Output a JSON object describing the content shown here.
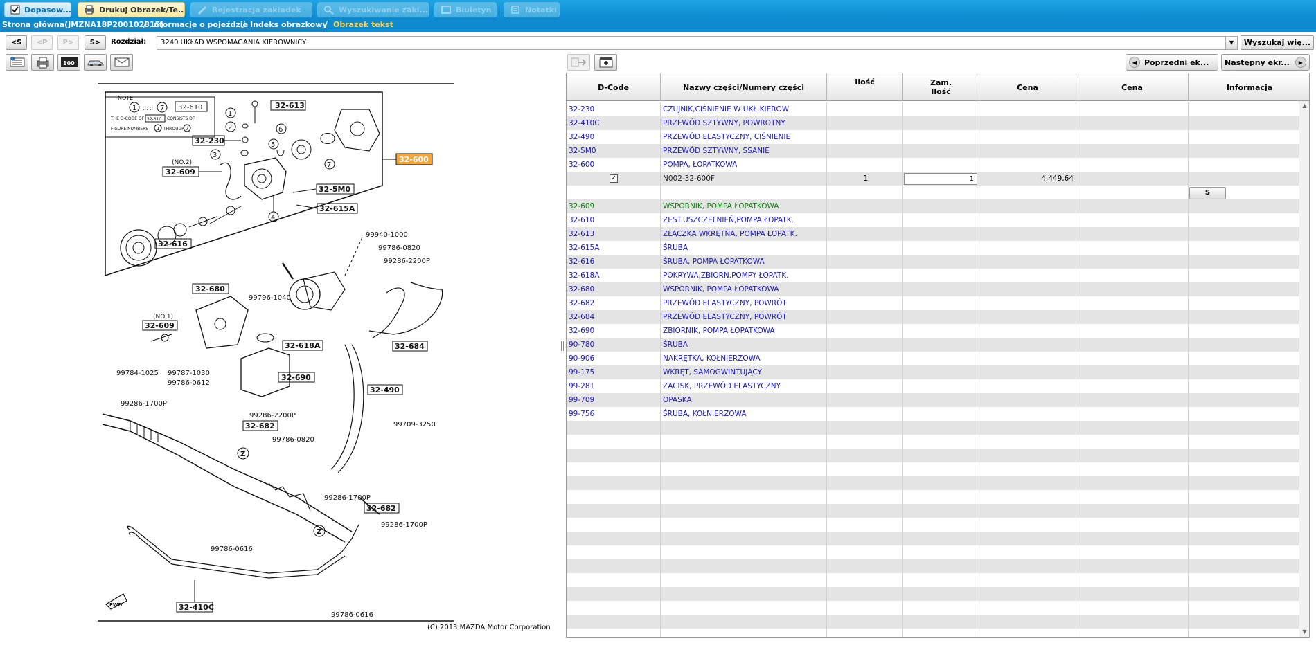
{
  "tabs": [
    {
      "label": "Dopasow...",
      "icon": "checkbox-icon",
      "state": "active-blue"
    },
    {
      "label": "Drukuj Obrazek/Te...",
      "icon": "printer-icon",
      "state": "active-yellow"
    },
    {
      "label": "Rejestracja zakładek",
      "icon": "pen-icon",
      "state": "disabled"
    },
    {
      "label": "Wyszukiwanie zaki...",
      "icon": "magnifier-icon",
      "state": "disabled"
    },
    {
      "label": "Biuletyn",
      "icon": "bulletin-icon",
      "state": "disabled"
    },
    {
      "label": "Notatki",
      "icon": "note-icon",
      "state": "disabled"
    }
  ],
  "breadcrumb": {
    "home": "Strona główna(JMZNA18P200102815)",
    "vehicle_info": "Informacje o pojeździe",
    "image_index": "Indeks obrazkowy",
    "current": "Obrazek tekst"
  },
  "section_nav": {
    "first": "<S",
    "prev": "<P",
    "next": "P>",
    "last": "S>",
    "label": "Rozdział:",
    "selected": "3240  UKŁAD WSPOMAGANIA KIEROWNICY",
    "search_button": "Wyszukaj wię..."
  },
  "paging": {
    "prev": "Poprzedni ek...",
    "next": "Następny ekr..."
  },
  "diagram": {
    "copyright": "(C) 2013 MAZDA Motor Corporation",
    "callouts": [
      "32-610",
      "32-613",
      "32-230",
      "32-609",
      "32-600",
      "32-5M0",
      "32-615A",
      "32-616",
      "32-680",
      "32-609",
      "32-618A",
      "32-684",
      "32-690",
      "32-490",
      "32-682",
      "32-682",
      "32-410C"
    ],
    "part_refs": [
      "99940-1000",
      "99786-0820",
      "99286-2200P",
      "99796-1040",
      "99784-1025",
      "99787-1030",
      "99786-0612",
      "99286-1700P",
      "99286-2200P",
      "99709-3250",
      "99786-0820",
      "99286-1700P",
      "99286-1700P",
      "99786-0616",
      "99786-0616"
    ],
    "note_title": "NOTE",
    "note_line1": "THE D-CODE OF",
    "note_code": "32-610",
    "note_line1b": "CONSISTS OF",
    "note_line2": "FIGURE NUMBERS",
    "note_line2b": "THROUGH",
    "no2": "(NO.2)",
    "no1": "(NO.1)",
    "fwd": "FWD"
  },
  "table": {
    "headers": {
      "dcode": "D-Code",
      "name": "Nazwy części/Numery części",
      "qty": "Ilość",
      "order_qty_1": "Zam.",
      "order_qty_2": "Ilość",
      "price1": "Cena",
      "price2": "Cena",
      "info": "Informacja"
    },
    "rows": [
      {
        "code": "32-230",
        "name": "CZUJNIK,CIŚNIENIE W UKŁ.KIEROW",
        "color": "blue"
      },
      {
        "code": "32-410C",
        "name": "PRZEWÓD SZTYWNY, POWROTNY",
        "color": "blue"
      },
      {
        "code": "32-490",
        "name": "PRZEWÓD ELASTYCZNY, CIŚNIENIE",
        "color": "blue"
      },
      {
        "code": "32-5M0",
        "name": "PRZEWÓD SZTYWNY, SSANIE",
        "color": "blue"
      },
      {
        "code": "32-600",
        "name": "POMPA, ŁOPATKOWA",
        "color": "blue"
      },
      {
        "code": "",
        "name": "N002-32-600F",
        "color": "dark",
        "qty": "1",
        "order_qty": "1",
        "price": "4,449,64",
        "checked": true
      },
      {
        "code": "",
        "name": "",
        "color": "dark",
        "button": "S"
      },
      {
        "code": "32-609",
        "name": "WSPORNIK, POMPA ŁOPATKOWA",
        "color": "green"
      },
      {
        "code": "32-610",
        "name": "ZEST.USZCZELNIEŃ,POMPA ŁOPATK.",
        "color": "blue"
      },
      {
        "code": "32-613",
        "name": "ZŁĄCZKA WKRĘTNA, POMPA ŁOPATK.",
        "color": "blue"
      },
      {
        "code": "32-615A",
        "name": "ŚRUBA",
        "color": "blue"
      },
      {
        "code": "32-616",
        "name": "ŚRUBA, POMPA ŁOPATKOWA",
        "color": "blue"
      },
      {
        "code": "32-618A",
        "name": "POKRYWA,ZBIORN.POMPY ŁOPATK.",
        "color": "blue"
      },
      {
        "code": "32-680",
        "name": "WSPORNIK, POMPA ŁOPATKOWA",
        "color": "blue"
      },
      {
        "code": "32-682",
        "name": "PRZEWÓD ELASTYCZNY, POWRÓT",
        "color": "blue"
      },
      {
        "code": "32-684",
        "name": "PRZEWÓD ELASTYCZNY, POWRÓT",
        "color": "blue"
      },
      {
        "code": "32-690",
        "name": "ZBIORNIK, POMPA ŁOPATKOWA",
        "color": "blue"
      },
      {
        "code": "90-780",
        "name": "ŚRUBA",
        "color": "blue"
      },
      {
        "code": "90-906",
        "name": "NAKRĘTKA, KOŁNIERZOWA",
        "color": "blue"
      },
      {
        "code": "99-175",
        "name": "WKRĘT, SAMOGWINTUJĄCY",
        "color": "blue"
      },
      {
        "code": "99-281",
        "name": "ZACISK, PRZEWÓD ELASTYCZNY",
        "color": "blue"
      },
      {
        "code": "99-709",
        "name": "OPASKA",
        "color": "blue"
      },
      {
        "code": "99-756",
        "name": "ŚRUBA, KOŁNIERZOWA",
        "color": "blue"
      }
    ]
  },
  "colors": {
    "topbar": "#0d8ad0",
    "breadcrumb_current": "#ffd24a",
    "link_blue": "#1a1ab4",
    "link_green": "#108010",
    "row_alt": "#e4e4e4",
    "callout_highlight": "#f4a63a"
  }
}
